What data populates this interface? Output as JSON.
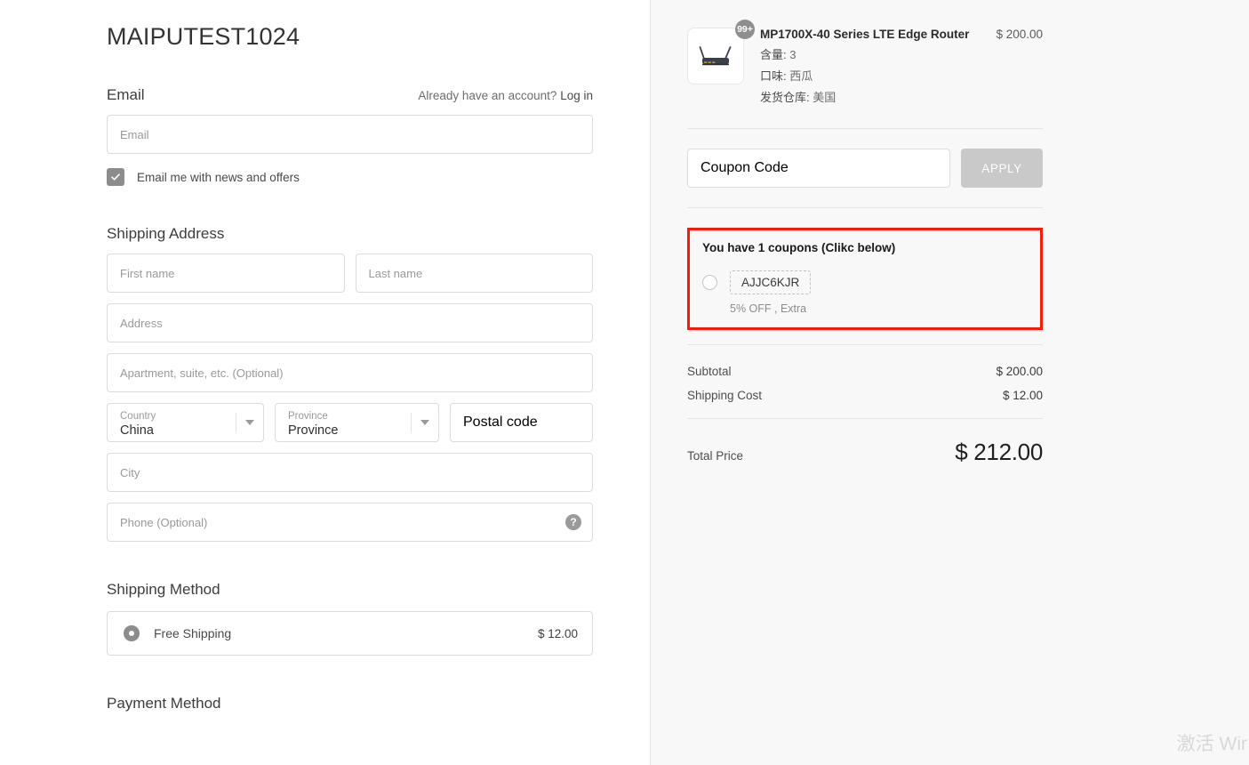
{
  "shop": {
    "title": "MAIPUTEST1024"
  },
  "email_section": {
    "heading": "Email",
    "account_prompt": "Already have an account?",
    "login_link": "Log in",
    "input_placeholder": "Email",
    "input_value": "",
    "newsletter_label": "Email me with news and offers",
    "newsletter_checked": "true"
  },
  "shipping_address": {
    "heading": "Shipping Address",
    "first_name_placeholder": "First name",
    "last_name_placeholder": "Last name",
    "address_placeholder": "Address",
    "apartment_placeholder": "Apartment, suite, etc. (Optional)",
    "country_label": "Country",
    "country_value": "China",
    "province_label": "Province",
    "province_value": "Province",
    "postal_placeholder": "Postal code",
    "city_placeholder": "City",
    "phone_placeholder": "Phone (Optional)",
    "help_icon_glyph": "?"
  },
  "shipping_method": {
    "heading": "Shipping Method",
    "option_label": "Free Shipping",
    "option_price": "$ 12.00",
    "selected": "true"
  },
  "payment_method": {
    "heading": "Payment Method"
  },
  "order_summary": {
    "product": {
      "badge": "99+",
      "title": "MP1700X-40 Series LTE Edge Router",
      "price": "$ 200.00",
      "attributes": [
        {
          "key": "含量:",
          "value": "3"
        },
        {
          "key": "口味:",
          "value": "西瓜"
        },
        {
          "key": "发货仓库:",
          "value": "美国"
        }
      ],
      "image_alt": "lte-edge-router"
    },
    "coupon": {
      "input_placeholder": "Coupon Code",
      "input_value": "",
      "apply_label": "APPLY",
      "available_heading": "You have 1 coupons (Clikc below)",
      "items": [
        {
          "code": "AJJC6KJR",
          "description": "5% OFF , Extra",
          "selected": "false"
        }
      ]
    },
    "totals": {
      "subtotal_label": "Subtotal",
      "subtotal_value": "$ 200.00",
      "shipping_label": "Shipping Cost",
      "shipping_value": "$ 12.00",
      "total_label": "Total Price",
      "total_value": "$ 212.00"
    }
  },
  "watermark": {
    "text": "激活 Wir"
  },
  "colors": {
    "accent_red": "#f81a0c",
    "panel_bg": "#f8f8f8",
    "button_gray": "#c9c9c9",
    "control_gray": "#8c8c8c"
  }
}
